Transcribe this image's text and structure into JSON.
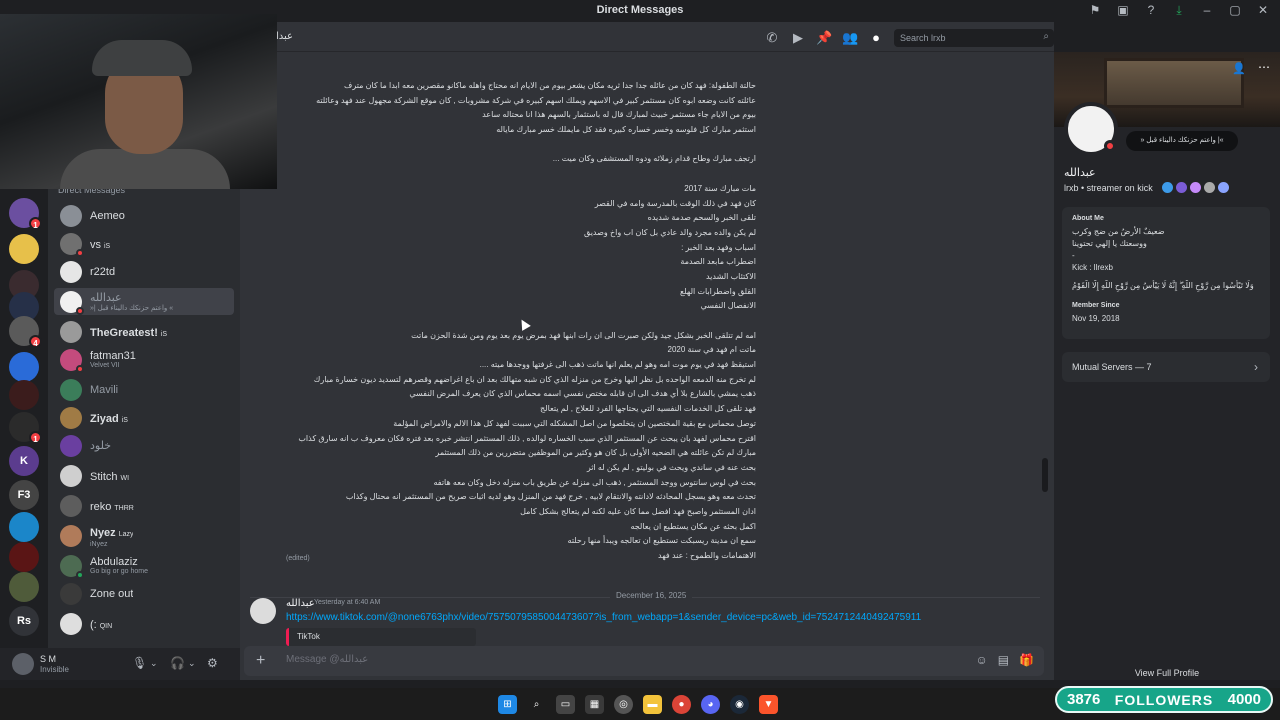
{
  "window": {
    "title": "Direct Messages"
  },
  "chat_header": {
    "name": "عبدا",
    "search_placeholder": "Search lrxb"
  },
  "dm_list": {
    "header": "Direct Messages",
    "items": [
      {
        "name": "Aemeo",
        "sub": "",
        "tag": ""
      },
      {
        "name": "vs",
        "sub": "",
        "tag": "iS"
      },
      {
        "name": "r22td",
        "sub": "",
        "tag": ""
      },
      {
        "name": "عبدالله",
        "sub": "»| واعتم حزنكك داليناء قبل «",
        "tag": ""
      },
      {
        "name": "TheGreatest!",
        "sub": "",
        "tag": "iS"
      },
      {
        "name": "fatman31",
        "sub": "Velvet VII",
        "tag": ""
      },
      {
        "name": "Mavili",
        "sub": "",
        "tag": ""
      },
      {
        "name": "Ziyad",
        "sub": "",
        "tag": "iS"
      },
      {
        "name": "خلود",
        "sub": "",
        "tag": ""
      },
      {
        "name": "Stitch",
        "sub": "",
        "tag": "WI"
      },
      {
        "name": "reko",
        "sub": "",
        "tag": "THRR"
      },
      {
        "name": "Nyez",
        "sub": "iNyez",
        "tag": "Lazy"
      },
      {
        "name": "Abdulaziz",
        "sub": "Go big or go home",
        "tag": ""
      },
      {
        "name": "Zone out",
        "sub": "",
        "tag": ""
      },
      {
        "name": "(:",
        "sub": "",
        "tag": "QIN"
      }
    ]
  },
  "user_panel": {
    "name": "S M",
    "status": "Invisible"
  },
  "message1": {
    "lines": [
      "حالتة الطفولة: فهد كان من عائله جدا جدا ثريه مكان يشعر بيوم من الايام انه محتاج واهله ماكانو مقصرين معه ابدا ما كان مترف",
      "عائلته كانت وضعه ابوه كان مستثمر كبير في الاسهم ويملك اسهم كبيره في شركة مشروبات , كان موقع الشركة مجهول عند فهد وعائلته",
      "بيوم من الايام جاء مستثمر خبيث لمبارك قال له باستثمار بالسهم هذا انا محتاله ساعد",
      "استثمر مبارك كل فلوسه وخسر خساره كبيره فقد كل مايملك خسر مبارك ماياله",
      "",
      "ارتجف مبارك وطاح قدام زملائه ودوه المستشفى وكان ميت ...",
      "",
      "مات مبارك سنة 2017",
      "كان فهد في ذلك الوقت بالمدرسة وامه في القصر",
      "تلقى الخبر والسحم صدمة شديده",
      "لم يكن والده مجرد والد عادي بل كان اب واخ وصديق",
      "اسباب وفهد بعد الخبر :",
      "اضطراب مابعد الصدمة",
      "الاكتئاب الشديد",
      "القلق واضطرابات الهلع",
      "الانفصال النفسي",
      "",
      "امه لم تتلقى الخبر بشكل جيد ولكن صبرت الى ان رات ابنها فهد بمرض يوم بعد يوم ومن شدة الحزن ماتت",
      "ماتت ام فهد في سنة 2020",
      "استيقظ فهد في يوم موت امه وهو لم يعلم انها ماتت ذهب الى غرفتها ووجدها ميته ....",
      "لم تخرج منه الدمعه الواحده بل نظر اليها وخرج من منزله الذي كان شبه متهالك بعد ان باع اغراضهم وقصرهم لتسديد ديون خسارة مبارك",
      "ذهب يمشي بالشارع بلا أي هدف الى ان قابله مختص نفسي اسمه محماس الذي كان يعرف المرض النفسي",
      "فهد تلقى كل الخدمات النفسيه التي يحتاجها الفرد للعلاج , لم يتعالج",
      "توصل محماس مع بقية المختصين ان يتخلصوا من اصل المشكله التي سببت لفهد كل هذا الالم والامراض المؤلمة",
      "اقترح محماس لفهد بان يبحث عن المستثمر الذي سبب الخساره لوالده , ذلك المستثمر انتشر خبره بعد فتره فكان معروف ب انه سارق كذاب",
      "مبارك لم تكن عائلته هي الضحيه الأولى بل كان هو وكثير من الموظفين متضررين من ذلك المستثمر",
      "بحث عنه في ساندي ويحث في بوليتو , لم يكن له اثر",
      "بحث في لوس سانتوس ووجد المستثمر , ذهب الى منزله عن طريق باب منزله دخل وكان معه هاتفه",
      "تحدث معه وهو يسجل المحادثه لادانته والانتقام لابيه , خرج فهد من المنزل وهو لديه اثبات صريح من المستثمر انه محتال وكذاب",
      "ادان المستثمر واصبح فهد افضل مما كان عليه لكنه لم يتعالج بشكل كامل",
      "اكمل بحثه عن مكان يستطيع ان يعالجه",
      "سمع ان مدينة ريسبكت تستطيع ان تعالجه ويبدأ منها رحلته",
      "الاهتمامات والطموح : عند فهد"
    ],
    "edited_label": "(edited)"
  },
  "date_divider": "December 16, 2025",
  "message2": {
    "author": "عبدالله",
    "time": "Yesterday at 6:40 AM",
    "link": "https://www.tiktok.com/@none6763phx/video/7575079585004473607?is_from_webapp=1&sender_device=pc&web_id=7524712440492475911",
    "embed_title": "TikTok"
  },
  "composer": {
    "placeholder": "Message @عبدالله"
  },
  "profile": {
    "display_name": "عبدالله",
    "username": "lrxb",
    "activity": "streamer on kick",
    "status_bubble": "»| واعتم حزنكك داليناء قبل «",
    "about_title": "About Me",
    "about_lines": [
      "ضعيفٌ الأرضُ من ضج وكرب",
      "ووسعتك يا إلهي تحتوينا",
      "-",
      "Kick : llrexb",
      "وَلَا تَيْأَسُوا مِن رَّوْحِ اللَّهِ ۖ إِنَّهُ لَا يَيْأَسُ مِن رَّوْحِ اللَّهِ إِلَّا الْقَوْمُ"
    ],
    "member_since_title": "Member Since",
    "member_since": "Nov 19, 2018",
    "mutual_servers": "Mutual Servers — 7",
    "view_full": "View Full Profile"
  },
  "overlay": {
    "followers_current": "3876",
    "followers_label": "FOLLOWERS",
    "followers_goal": "4000"
  },
  "colors": {
    "accent": "#5865f2",
    "link": "#00a8fc",
    "dnd": "#f23f43",
    "online": "#23a55a",
    "followers_bg": "#17a589"
  }
}
